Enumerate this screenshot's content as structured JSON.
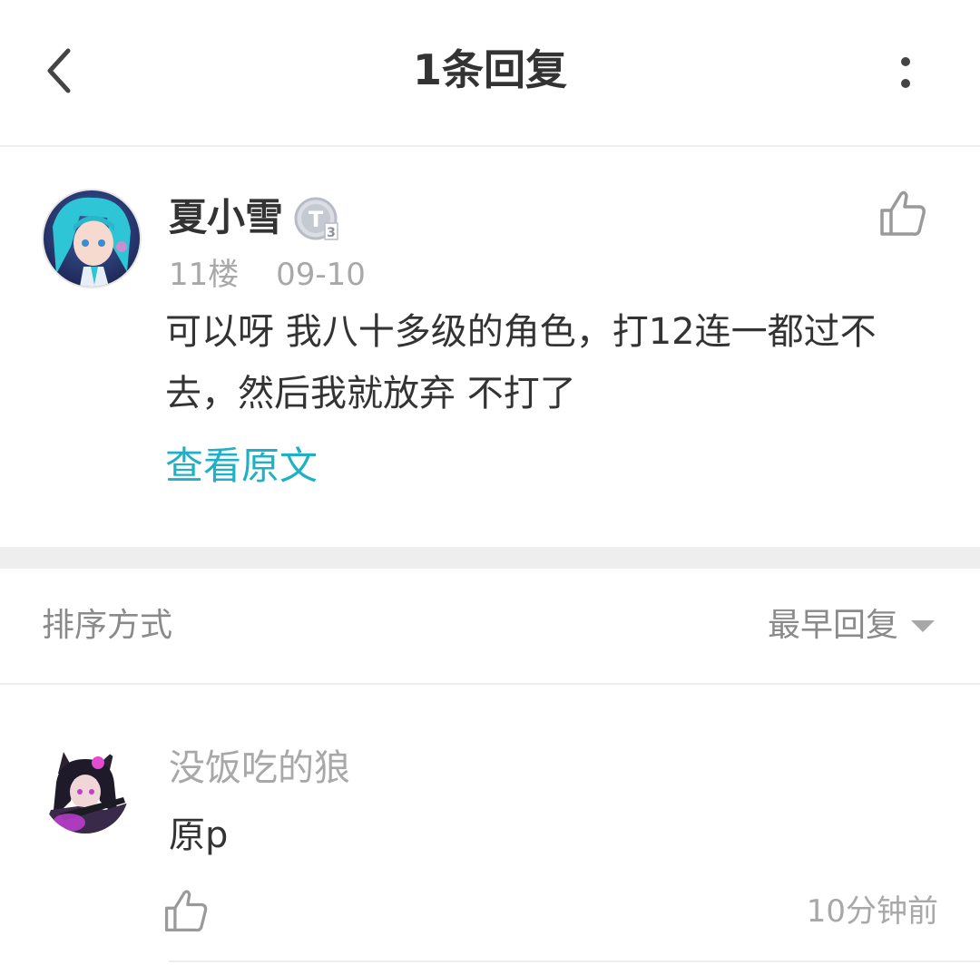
{
  "header": {
    "title": "1条回复",
    "back_icon": "chevron-left-icon",
    "more_icon": "more-vertical-icon"
  },
  "post": {
    "username": "夏小雪",
    "level_badge": "T3",
    "floor": "11楼",
    "date": "09-10",
    "content": "可以呀 我八十多级的角色，打12连一都过不去，然后我就放弃 不打了",
    "view_original": "查看原文",
    "like_icon": "thumbs-up-icon"
  },
  "sort": {
    "label": "排序方式",
    "selected": "最早回复"
  },
  "reply": {
    "username": "没饭吃的狼",
    "content": "原p",
    "time": "10分钟前",
    "like_icon": "thumbs-up-icon"
  },
  "colors": {
    "accent": "#1fb0c5",
    "text_primary": "#333333",
    "text_secondary": "#a8a8a8",
    "divider": "#eeeeee"
  }
}
